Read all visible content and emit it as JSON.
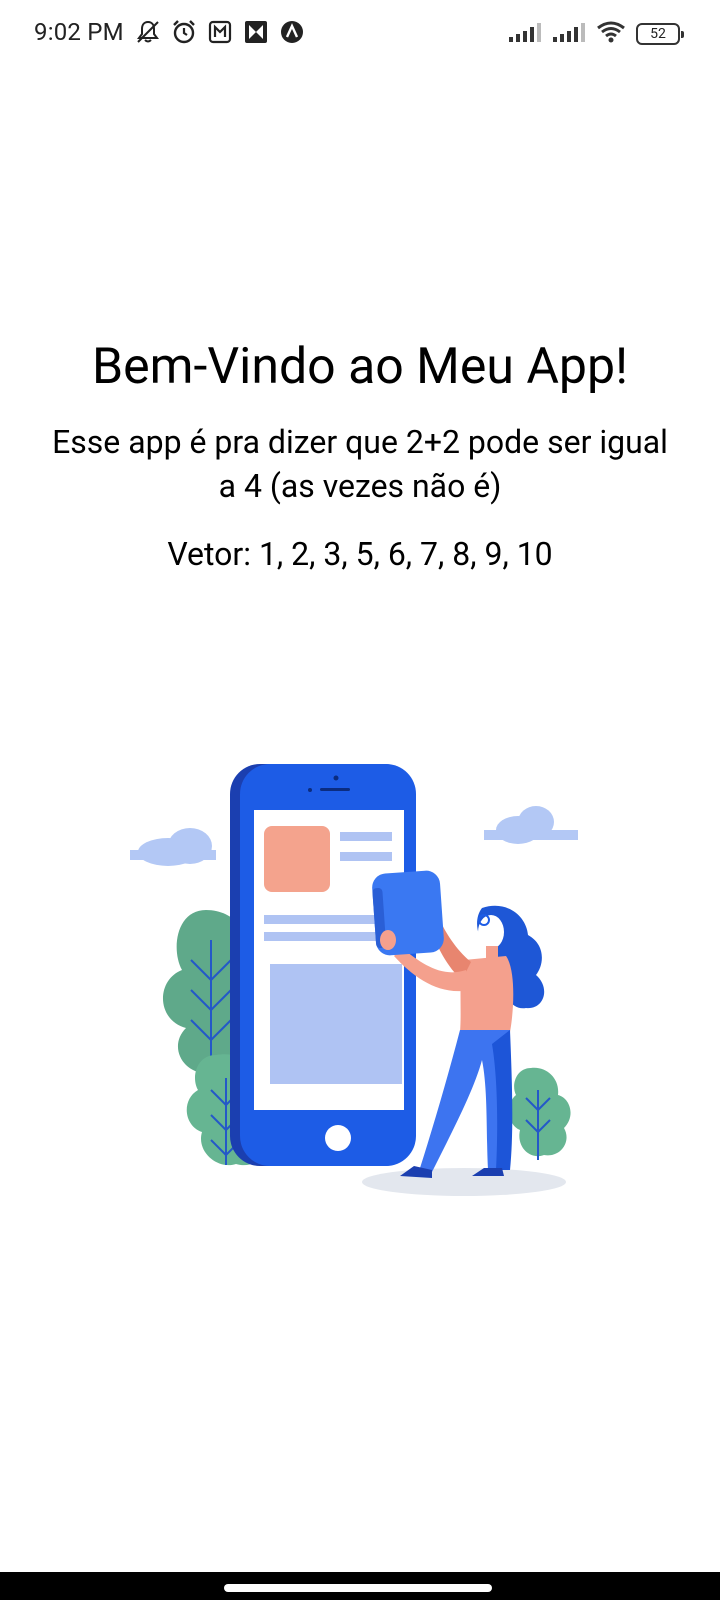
{
  "status_bar": {
    "time": "9:02 PM",
    "battery_level": "52",
    "icons": [
      "notifications-off-icon",
      "alarm-icon",
      "nfc-icon",
      "app-notification-icon",
      "app-notification-icon",
      "signal-icon",
      "signal-icon",
      "wifi-icon",
      "battery-icon"
    ]
  },
  "main": {
    "title": "Bem-Vindo ao Meu App!",
    "subtitle": "Esse app é pra dizer que 2+2 pode ser igual a 4 (as vezes não é)",
    "vector_label": "Vetor: ",
    "vector_values": "1, 2, 3, 5, 6, 7, 8, 9, 10"
  },
  "illustration": {
    "description_icon": "woman-with-phone-illustration",
    "colors": {
      "phone": "#1d5ce6",
      "phone_dark": "#1b3fb0",
      "card": "#f4a38d",
      "panel": "#afc3f3",
      "leaf": "#5fa98a",
      "leaf_light": "#66b592",
      "cloud": "#b3c8f5",
      "shadow": "#e3e7ee",
      "skin": "#f4a08d",
      "hair": "#1e57d6",
      "pants": "#3d74f0"
    }
  },
  "nav": {
    "home_indicator": "home-indicator"
  }
}
